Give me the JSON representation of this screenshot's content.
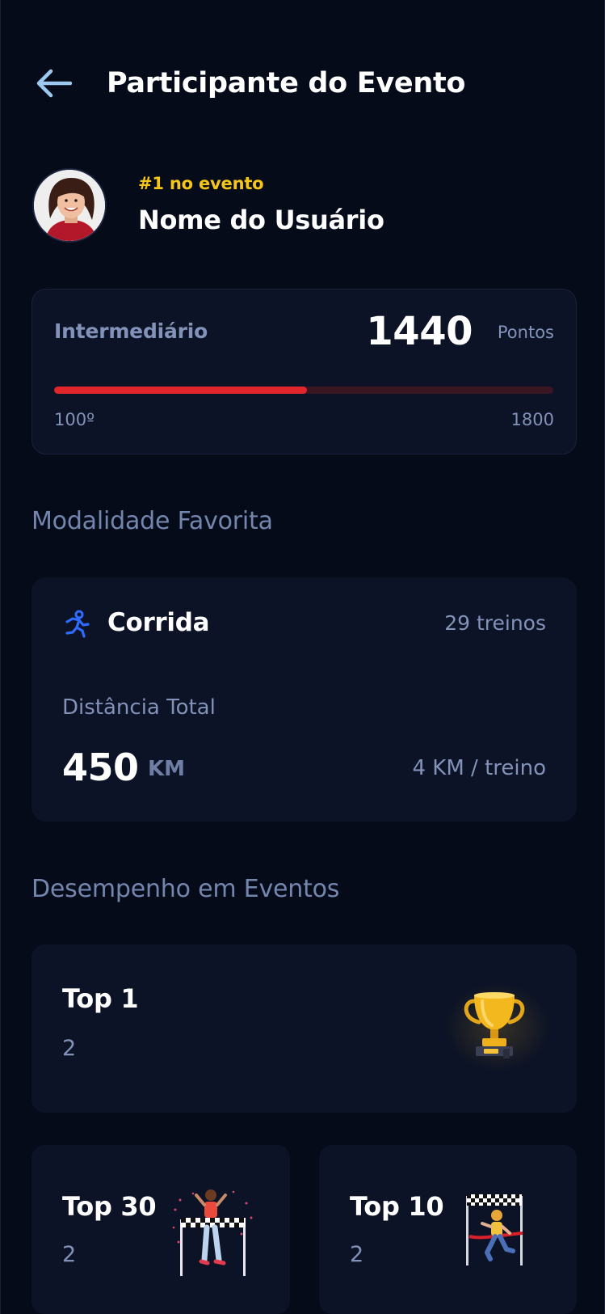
{
  "header": {
    "back_icon": "arrow-left-icon",
    "title": "Participante do Evento"
  },
  "profile": {
    "rank": "#1 no evento",
    "name": "Nome do Usuário"
  },
  "points_card": {
    "level": "Intermediário",
    "points": "1440",
    "points_unit": "Pontos",
    "progress_min": "100º",
    "progress_max": "1800",
    "progress_fraction": 0.507
  },
  "favorite_modality": {
    "section_title": "Modalidade Favorita",
    "icon": "runner-icon",
    "name": "Corrida",
    "workouts": "29 treinos",
    "distance_label": "Distância Total",
    "distance_value": "450",
    "distance_unit": "KM",
    "per_workout": "4 KM / treino"
  },
  "performance": {
    "section_title": "Desempenho em Eventos",
    "cards": [
      {
        "title": "Top 1",
        "count": "2",
        "icon": "trophy-icon"
      },
      {
        "title": "Top 30",
        "count": "2",
        "icon": "finish-line-celebration-icon"
      },
      {
        "title": "Top 10",
        "count": "2",
        "icon": "finish-line-runner-icon"
      }
    ]
  },
  "colors": {
    "background": "#060b1a",
    "card": "#0d1326",
    "accent_gold": "#f5c518",
    "progress_red": "#e0262b",
    "muted_text": "#8392b8",
    "runner_blue": "#2f6bff"
  }
}
